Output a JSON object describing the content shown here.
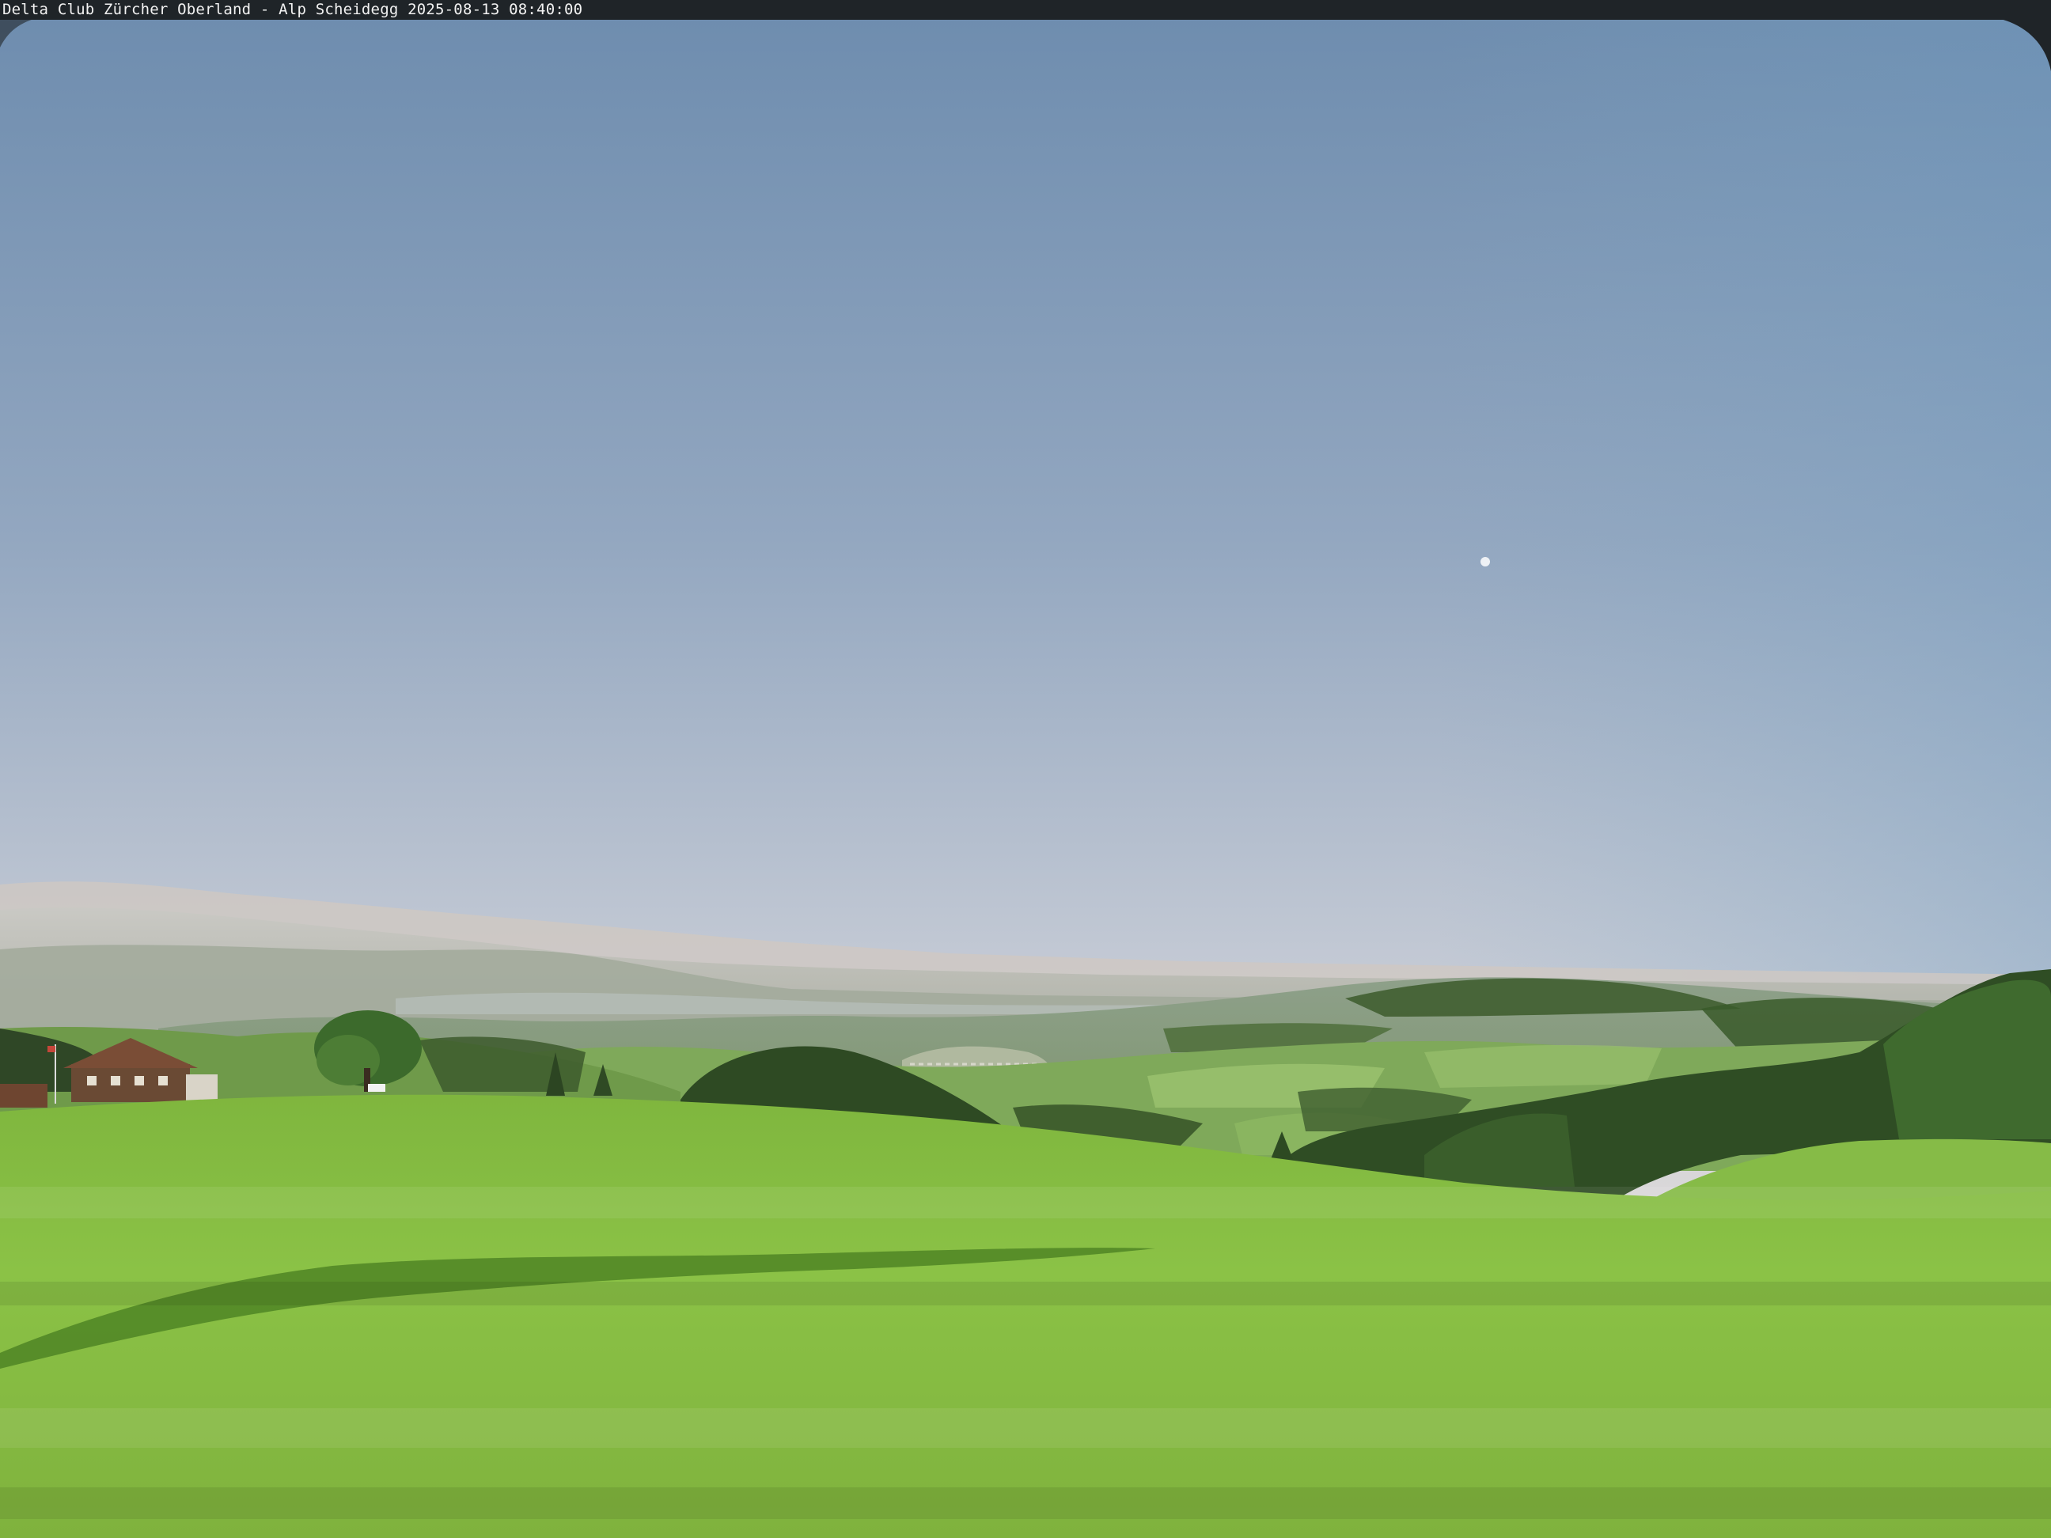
{
  "webcam": {
    "caption": "Delta Club Zürcher Oberland - Alp Scheidegg 2025-08-13 08:40:00"
  },
  "colors": {
    "sky_top": "#6e8fb2",
    "sky_mid": "#a9b8cc",
    "sky_horizon": "#ece3dc",
    "meadow_light": "#8cc347",
    "meadow_dark": "#5c9a2a",
    "forest": "#2f4a22",
    "overlay_bar": "#1f2428"
  }
}
